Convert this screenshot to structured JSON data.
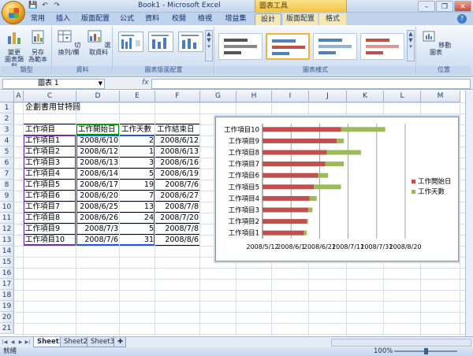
{
  "window": {
    "title": "Book1 - Microsoft Excel",
    "contextual_group": "圖表工具",
    "controls": {
      "minimize": "–",
      "restore": "❐",
      "close": "✕"
    }
  },
  "qat": {
    "save": "💾",
    "undo": "↶",
    "redo": "↷"
  },
  "tabs": [
    {
      "label": "常用"
    },
    {
      "label": "插入"
    },
    {
      "label": "版面配置"
    },
    {
      "label": "公式"
    },
    {
      "label": "資料"
    },
    {
      "label": "校閱"
    },
    {
      "label": "檢視"
    },
    {
      "label": "增益集"
    },
    {
      "label": "設計"
    },
    {
      "label": "版面配置"
    },
    {
      "label": "格式"
    }
  ],
  "ribbon": {
    "groups": {
      "type": {
        "label": "類型",
        "change_type": "變更\n圖表類型",
        "save_template": "另存\n為範本"
      },
      "data": {
        "label": "資料",
        "switch_row_col": "切換列/欄",
        "select_data": "選取資料"
      },
      "layouts": {
        "label": "圖表版面配置"
      },
      "styles": {
        "label": "圖表樣式"
      },
      "location": {
        "label": "位置",
        "move_chart": "移動圖表"
      }
    }
  },
  "formula_bar": {
    "name_box": "圖表 1",
    "fx": "fx",
    "formula": ""
  },
  "columns": [
    "A",
    "C",
    "D",
    "E",
    "F",
    "G",
    "H",
    "I",
    "J",
    "K",
    "L",
    "M"
  ],
  "rows": [
    "1",
    "2",
    "3",
    "4",
    "5",
    "6",
    "7",
    "8",
    "9",
    "10",
    "11",
    "12",
    "13",
    "14",
    "15",
    "16",
    "17",
    "18",
    "19",
    "20",
    "21"
  ],
  "sheet": {
    "title": "企劃書用甘特圖",
    "headers": [
      "工作項目",
      "工作開始日",
      "工作天數",
      "工作結束日"
    ],
    "table": [
      [
        "工作項目1",
        "2008/6/10",
        "2",
        "2008/6/12"
      ],
      [
        "工作項目2",
        "2008/6/12",
        "1",
        "2008/6/13"
      ],
      [
        "工作項目3",
        "2008/6/13",
        "3",
        "2008/6/16"
      ],
      [
        "工作項目4",
        "2008/6/14",
        "5",
        "2008/6/19"
      ],
      [
        "工作項目5",
        "2008/6/17",
        "19",
        "2008/7/6"
      ],
      [
        "工作項目6",
        "2008/6/20",
        "7",
        "2008/6/27"
      ],
      [
        "工作項目7",
        "2008/6/25",
        "13",
        "2008/7/8"
      ],
      [
        "工作項目8",
        "2008/6/26",
        "24",
        "2008/7/20"
      ],
      [
        "工作項目9",
        "2008/7/3",
        "5",
        "2008/7/8"
      ],
      [
        "工作項目10",
        "2008/7/6",
        "31",
        "2008/8/6"
      ]
    ]
  },
  "chart_data": {
    "type": "bar",
    "orientation": "horizontal",
    "stacked": true,
    "categories": [
      "工作項目1",
      "工作項目2",
      "工作項目3",
      "工作項目4",
      "工作項目5",
      "工作項目6",
      "工作項目7",
      "工作項目8",
      "工作項目9",
      "工作項目10"
    ],
    "series": [
      {
        "name": "工作開始日",
        "color": "#c0504d",
        "values": [
          "2008/6/10",
          "2008/6/12",
          "2008/6/13",
          "2008/6/14",
          "2008/6/17",
          "2008/6/20",
          "2008/6/25",
          "2008/6/26",
          "2008/7/3",
          "2008/7/6"
        ]
      },
      {
        "name": "工作天數",
        "color": "#9bbb59",
        "values": [
          2,
          1,
          3,
          5,
          19,
          7,
          13,
          24,
          5,
          31
        ]
      }
    ],
    "x_ticks": [
      "2008/5/12",
      "2008/6/1",
      "2008/6/21",
      "2008/7/11",
      "2008/7/31",
      "2008/8/20"
    ],
    "xlim": [
      "2008/5/12",
      "2008/8/20"
    ],
    "grid": true,
    "legend": "right"
  },
  "sheet_tabs": [
    "Sheet1",
    "Sheet2",
    "Sheet3"
  ],
  "status": {
    "ready": "就緒",
    "zoom": "100%"
  }
}
